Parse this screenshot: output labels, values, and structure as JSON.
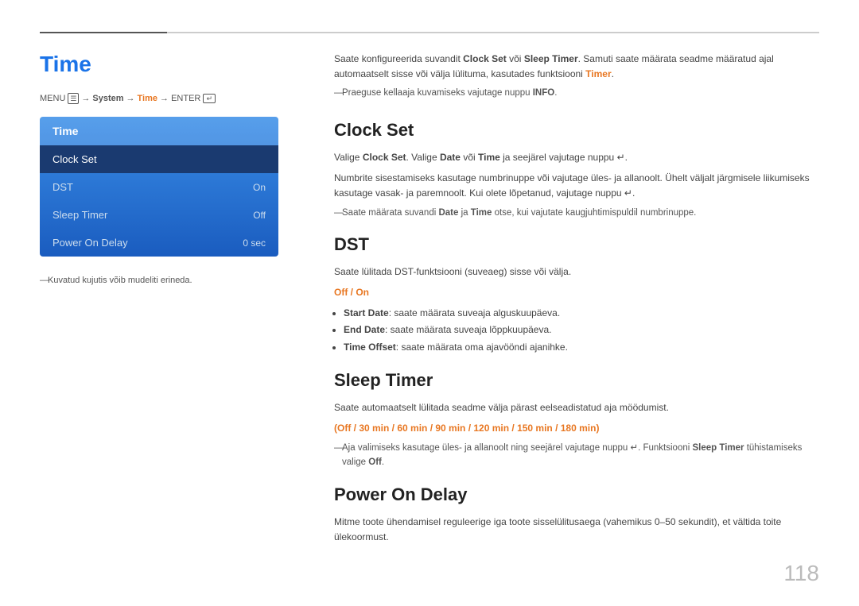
{
  "page": {
    "title": "Time",
    "number": "118"
  },
  "menu_path": {
    "prefix": "MENU",
    "menu_icon": "☰",
    "items": [
      "System",
      "Time"
    ],
    "suffix": "ENTER",
    "enter_icon": "↵"
  },
  "menu": {
    "header": "Time",
    "items": [
      {
        "label": "Clock Set",
        "value": "",
        "selected": true
      },
      {
        "label": "DST",
        "value": "On",
        "selected": false
      },
      {
        "label": "Sleep Timer",
        "value": "Off",
        "selected": false
      },
      {
        "label": "Power On Delay",
        "value": "0 sec",
        "selected": false
      }
    ]
  },
  "left_note": "Kuvatud kujutis võib mudeliti erineda.",
  "intro": {
    "text": "Saate konfigureerida suvandit Clock Set või Sleep Timer. Samuti saate määrata seadme määratud ajal automaatselt sisse või välja lülituma, kasutades funktsiooni Timer.",
    "note": "Praeguse kellaaja kuvamiseks vajutage nuppu INFO."
  },
  "sections": [
    {
      "id": "clock-set",
      "title": "Clock Set",
      "paragraphs": [
        "Valige Clock Set. Valige Date või Time ja seejärel vajutage nuppu ↵.",
        "Numbrite sisestamiseks kasutage numbrinuppe või vajutage üles- ja allanoolt. Ühelt väljalt järgmisele liikumiseks kasutage vasak- ja paremnoolt. Kui olete lõpetanud, vajutage nuppu ↵."
      ],
      "note": "Saate määrata suvandi Date ja Time otse, kui vajutate kaugjuhtimispuldil numbrinuppe.",
      "orange_text": null,
      "bullets": []
    },
    {
      "id": "dst",
      "title": "DST",
      "paragraphs": [
        "Saate lülitada DST-funktsiooni (suveaeg) sisse või välja."
      ],
      "orange_text": "Off / On",
      "bullets": [
        "Start Date: saate määrata suveaja alguskuupäeva.",
        "End Date: saate määrata suveaja lõppkuupäeva.",
        "Time Offset: saate määrata oma ajavööndi ajanihke."
      ],
      "note": null
    },
    {
      "id": "sleep-timer",
      "title": "Sleep Timer",
      "paragraphs": [
        "Saate automaatselt lülitada seadme välja pärast eelseadistatud aja möödumist."
      ],
      "orange_text": "(Off / 30 min / 60 min / 90 min / 120 min / 150 min / 180 min)",
      "bullets": [],
      "note": "Aja valimiseks kasutage üles- ja allanoolt ning seejärel vajutage nuppu ↵. Funktsiooni Sleep Timer tühistamiseks valige Off."
    },
    {
      "id": "power-on-delay",
      "title": "Power On Delay",
      "paragraphs": [
        "Mitme toote ühendamisel reguleerige iga toote sisselülitusaega (vahemikus 0–50 sekundit), et vältida toite ülekoormust."
      ],
      "orange_text": null,
      "bullets": [],
      "note": null
    }
  ]
}
